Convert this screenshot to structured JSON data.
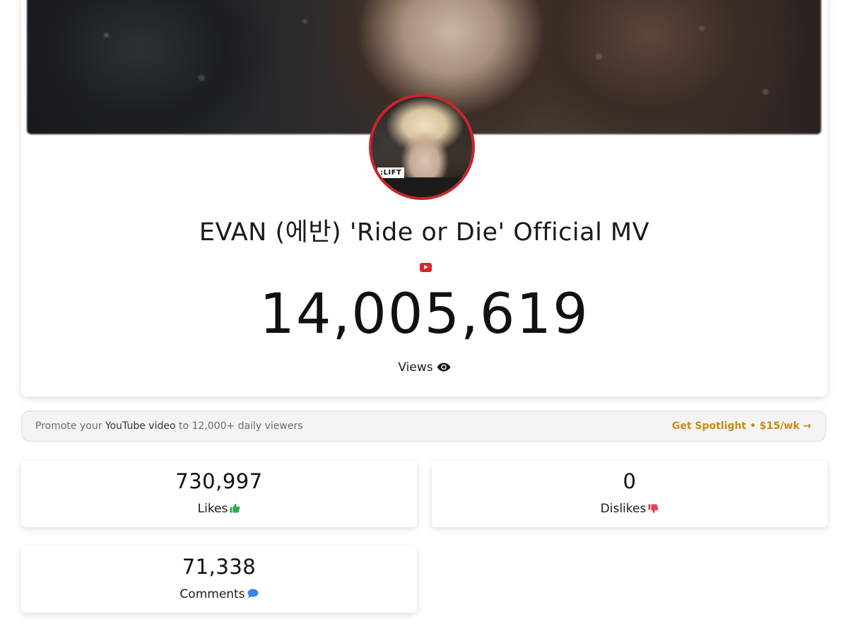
{
  "video": {
    "title": "EVAN (에반) 'Ride or Die' Official MV",
    "platform_icon": "youtube-icon",
    "avatar_tag": ":LIFT",
    "views": "14,005,619",
    "views_label": "Views"
  },
  "promo": {
    "text_prefix": "Promote your ",
    "text_emphasis": "YouTube video",
    "text_suffix": " to 12,000+ daily viewers",
    "link_label": "Get Spotlight • $15/wk →"
  },
  "stats": {
    "likes": {
      "value": "730,997",
      "label": "Likes",
      "icon": "thumbs-up-icon"
    },
    "dislikes": {
      "value": "0",
      "label": "Dislikes",
      "icon": "thumbs-down-icon"
    },
    "comments": {
      "value": "71,338",
      "label": "Comments",
      "icon": "comment-icon"
    }
  },
  "colors": {
    "avatar_border": "#c8262b",
    "youtube_red": "#d6262b",
    "promo_link": "#c98a16",
    "likes_icon": "#2fa84f",
    "dislikes_icon": "#e0484d",
    "comments_icon": "#3b82e6"
  }
}
